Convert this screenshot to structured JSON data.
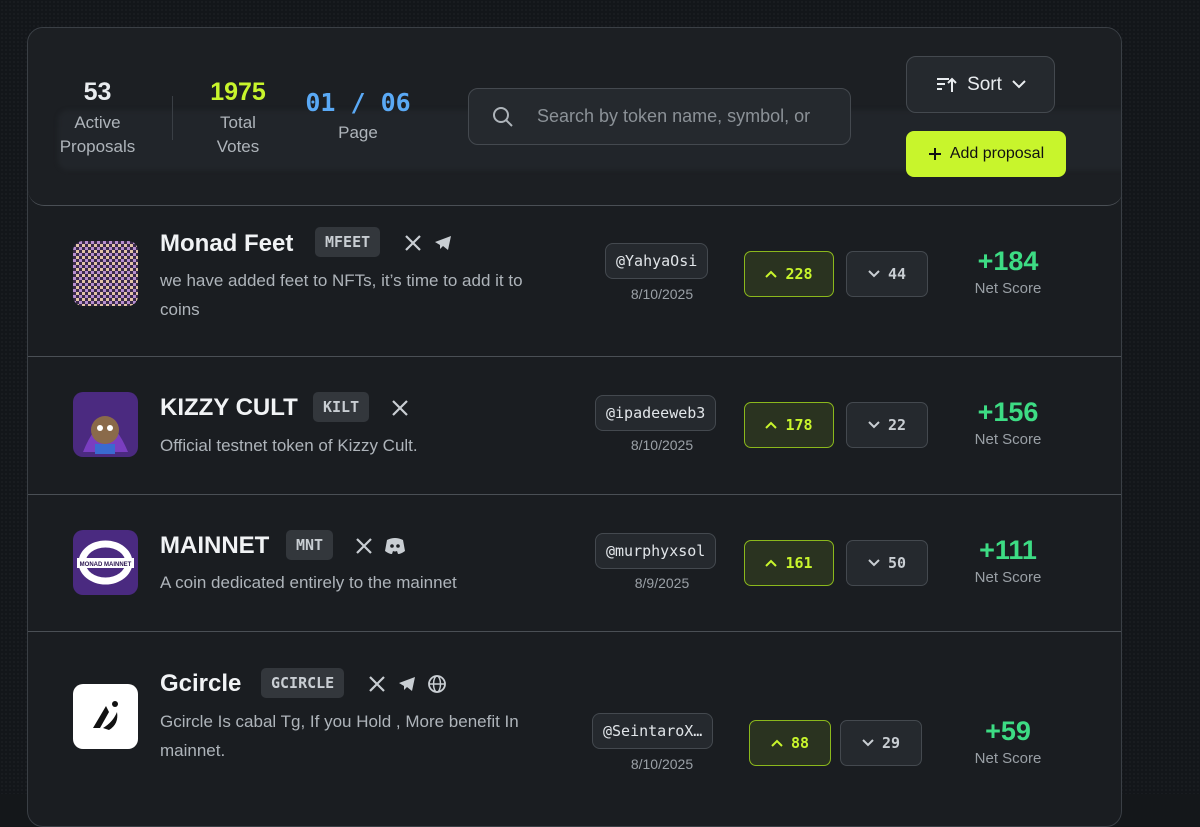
{
  "header": {
    "active_proposals": {
      "value": "53",
      "label_line1": "Active",
      "label_line2": "Proposals"
    },
    "total_votes": {
      "value": "1975",
      "label_line1": "Total",
      "label_line2": "Votes"
    },
    "page": {
      "value": "01 / 06",
      "label": "Page"
    },
    "search": {
      "placeholder": "Search by token name, symbol, or"
    },
    "sort_label": "Sort",
    "add_label": "Add proposal"
  },
  "colors": {
    "accent": "#c8f52c",
    "score": "#3ddc84",
    "page": "#5aa9f5",
    "total_votes": "#c8f52c"
  },
  "proposals": [
    {
      "name": "Monad Feet",
      "symbol": "MFEET",
      "socials": [
        "x-icon",
        "telegram-icon"
      ],
      "desc_line1": "we have added feet to NFTs, it’s time to add it to",
      "desc_line2": "coins",
      "handle": "@YahyaOsi",
      "date": "8/10/2025",
      "up": "228",
      "down": "44",
      "score": "+184",
      "score_label": "Net Score"
    },
    {
      "name": "KIZZY CULT",
      "symbol": "KILT",
      "socials": [
        "x-icon"
      ],
      "desc_line1": "Official testnet token of Kizzy Cult.",
      "desc_line2": "",
      "handle": "@ipadeeweb3",
      "date": "8/10/2025",
      "up": "178",
      "down": "22",
      "score": "+156",
      "score_label": "Net Score"
    },
    {
      "name": "MAINNET",
      "symbol": "MNT",
      "socials": [
        "x-icon",
        "discord-icon"
      ],
      "desc_line1": "A coin dedicated entirely to the mainnet",
      "desc_line2": "",
      "handle": "@murphyxsol",
      "date": "8/9/2025",
      "up": "161",
      "down": "50",
      "score": "+111",
      "score_label": "Net Score",
      "logo_text": "MONAD MAINNET"
    },
    {
      "name": "Gcircle",
      "symbol": "GCIRCLE",
      "socials": [
        "x-icon",
        "telegram-icon",
        "globe-icon"
      ],
      "desc_line1": "Gcircle Is cabal Tg, If you Hold , More benefit In",
      "desc_line2": "mainnet.",
      "handle": "@SeintaroX…",
      "date": "8/10/2025",
      "up": "88",
      "down": "29",
      "score": "+59",
      "score_label": "Net Score"
    }
  ]
}
